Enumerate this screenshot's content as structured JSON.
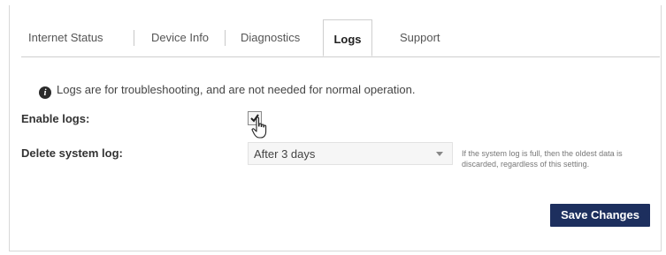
{
  "tabs": {
    "internet_status": "Internet Status",
    "device_info": "Device Info",
    "diagnostics": "Diagnostics",
    "logs": "Logs",
    "support": "Support",
    "active": "Logs"
  },
  "info": {
    "icon": "info-circle",
    "text": "Logs are for troubleshooting, and are not needed for normal operation."
  },
  "form": {
    "enable_logs_label": "Enable logs:",
    "enable_logs_checked": true,
    "delete_log_label": "Delete system log:",
    "delete_log_value": "After 3 days",
    "delete_log_hint": "If the system log is full, then the oldest data is discarded, regardless of this setting."
  },
  "actions": {
    "save_label": "Save Changes"
  },
  "colors": {
    "save_button_bg": "#1d2f5e",
    "tab_border": "#cfcfcf"
  }
}
